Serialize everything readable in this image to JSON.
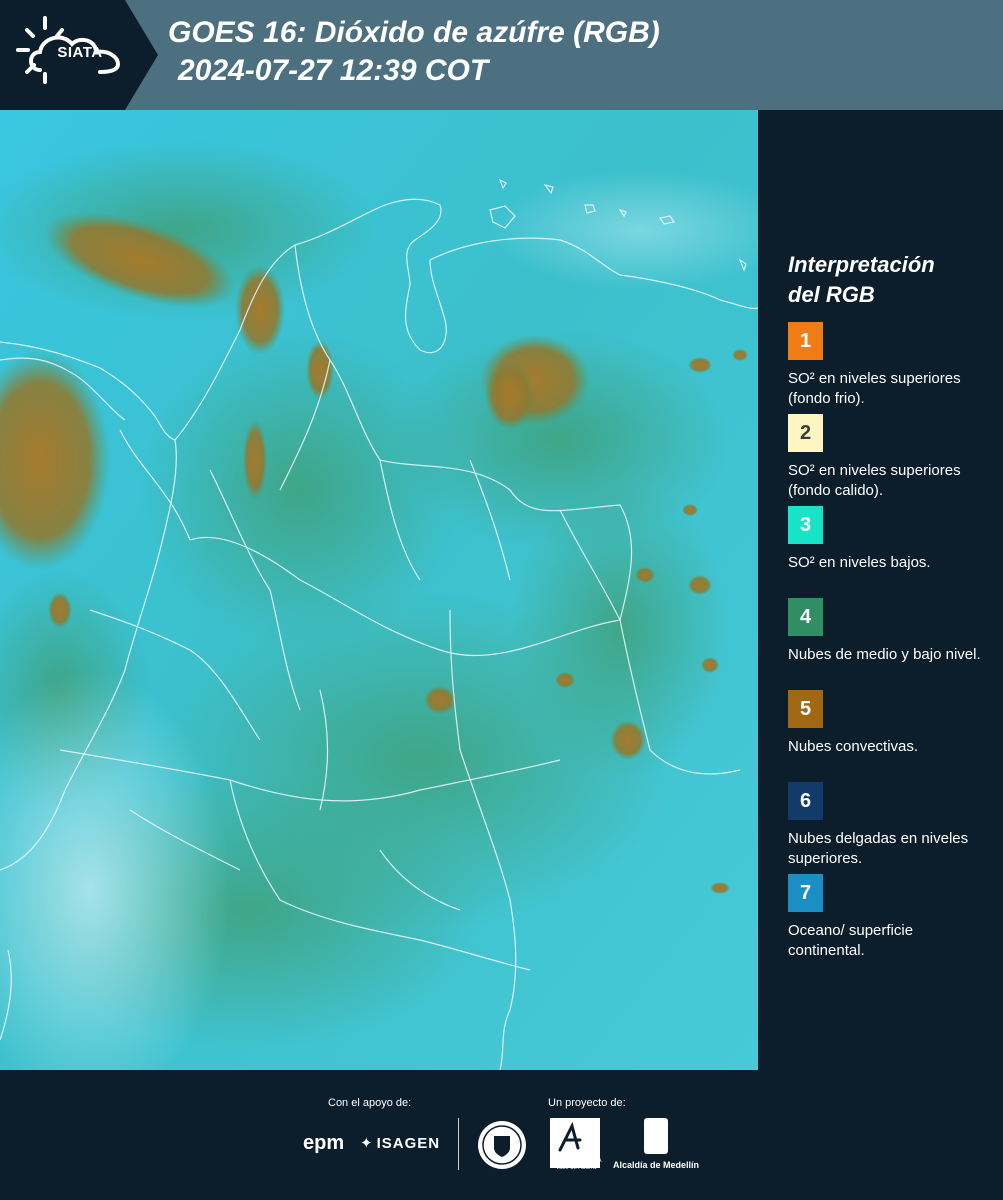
{
  "header": {
    "logo_text": "SIATA",
    "title_line1": "GOES 16: Dióxido de azúfre (RGB)",
    "title_line2": "2024-07-27 12:39 COT"
  },
  "legend": {
    "title_line1": "Interpretación",
    "title_line2": "del RGB",
    "items": [
      {
        "number": "1",
        "color": "#f07c16",
        "label": "SO² en niveles superiores (fondo frio)."
      },
      {
        "number": "2",
        "color": "#fdf6c3",
        "label": "SO² en niveles superiores (fondo calido)."
      },
      {
        "number": "3",
        "color": "#17e3c7",
        "label": "SO² en niveles bajos."
      },
      {
        "number": "4",
        "color": "#2f8f63",
        "label": "Nubes de medio y bajo nivel."
      },
      {
        "number": "5",
        "color": "#a06812",
        "label": "Nubes convectivas."
      },
      {
        "number": "6",
        "color": "#123a6b",
        "label": "Nubes delgadas en niveles superiores."
      },
      {
        "number": "7",
        "color": "#1a8fc4",
        "label": "Oceano/ superficie continental."
      }
    ]
  },
  "footer": {
    "support_label": "Con el apoyo de:",
    "project_label": "Un proyecto de:",
    "epm": "epm",
    "isagen": "ISAGEN",
    "amva_line1": "METROPOLITANA",
    "amva_line2": "Valle de Aburrá",
    "alcaldia": "Alcaldía de Medellín"
  }
}
